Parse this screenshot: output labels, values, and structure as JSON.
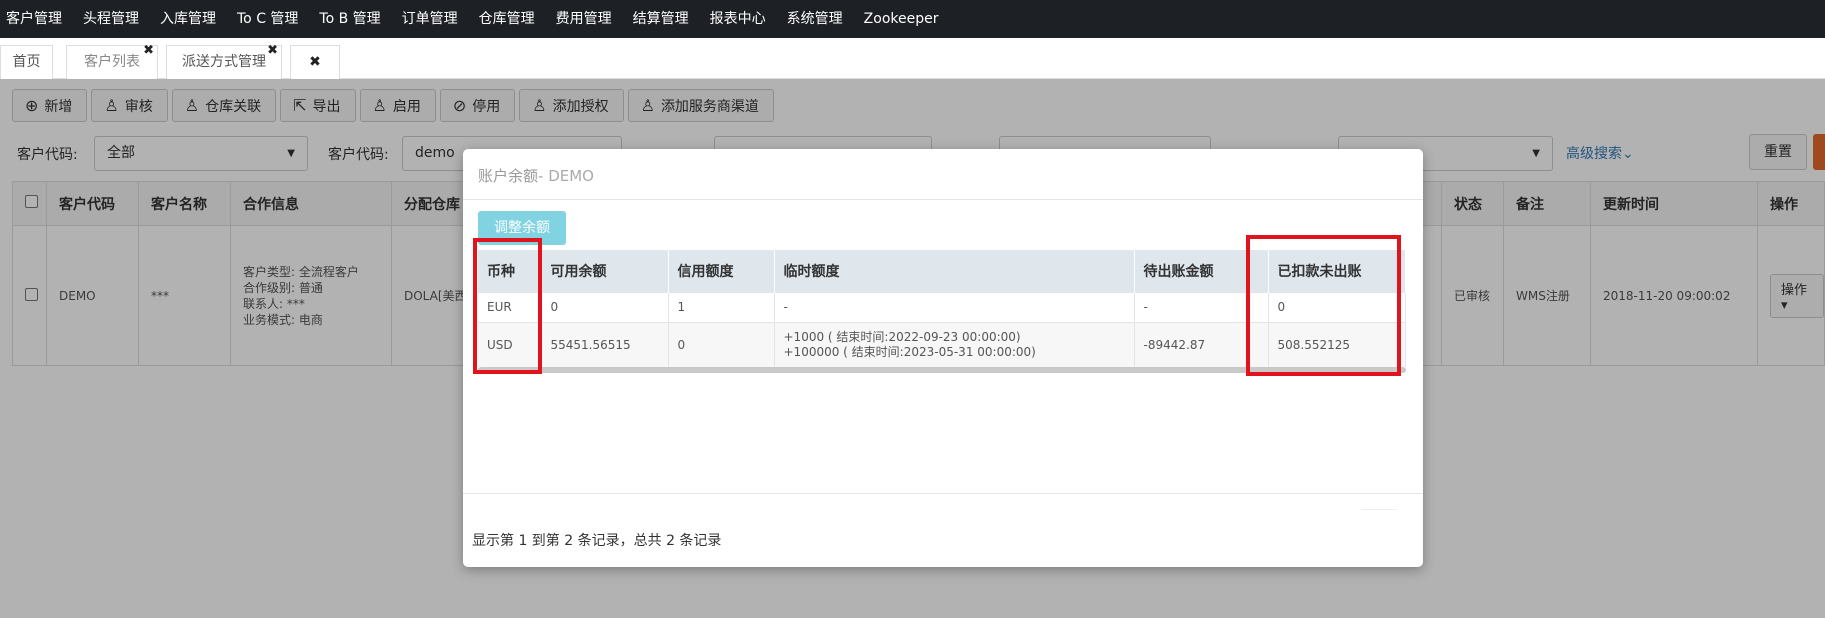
{
  "topnav": [
    "客户管理",
    "头程管理",
    "入库管理",
    "To C 管理",
    "To B 管理",
    "订单管理",
    "仓库管理",
    "费用管理",
    "结算管理",
    "报表中心",
    "系统管理",
    "Zookeeper"
  ],
  "tabs": {
    "home": "首页",
    "customers": "客户列表",
    "delivery": "派送方式管理",
    "close_all": "✖"
  },
  "toolbar": [
    "新增",
    "审核",
    "仓库关联",
    "导出",
    "启用",
    "停用",
    "添加授权",
    "添加服务商渠道"
  ],
  "search": {
    "label1": "客户代码:",
    "value1": "全部",
    "label2": "客户代码:",
    "value2": "demo",
    "reset": "重置",
    "advanced": "高级搜索"
  },
  "main_table": {
    "headers": [
      "客户代码",
      "客户名称",
      "合作信息",
      "分配仓库",
      "状态",
      "备注",
      "更新时间",
      "操作"
    ],
    "row": {
      "code": "DEMO",
      "name": "***",
      "coop": [
        "客户类型: 全流程客户",
        "合作级别: 普通",
        "联系人: ***",
        "业务模式: 电商"
      ],
      "warehouse": "DOLA[美西",
      "status": "已审核",
      "remark": "WMS注册",
      "updated": "2018-11-20 09:00:02",
      "action": "操作"
    }
  },
  "modal": {
    "title": "账户余额",
    "title_suffix": "- DEMO",
    "adjust_button": "调整余额",
    "headers": [
      "币种",
      "可用余额",
      "信用额度",
      "临时额度",
      "待出账金额",
      "已扣款未出账"
    ],
    "rows": [
      {
        "currency": "EUR",
        "available": "0",
        "credit": "1",
        "temp": [
          "-"
        ],
        "pending": "-",
        "deducted": "0"
      },
      {
        "currency": "USD",
        "available": "55451.56515",
        "credit": "0",
        "temp": [
          "+1000 ( 结束时间:2022-09-23 00:00:00)",
          "+100000 ( 结束时间:2023-05-31 00:00:00)"
        ],
        "pending": "-89442.87",
        "deducted": "508.552125"
      }
    ],
    "page_info": "显示第 1 到第 2 条记录，总共 2 条记录"
  },
  "colors": {
    "highlight": "#e0141e",
    "adjust_button": "#81d3e1",
    "nav_bg": "#1d2126"
  }
}
